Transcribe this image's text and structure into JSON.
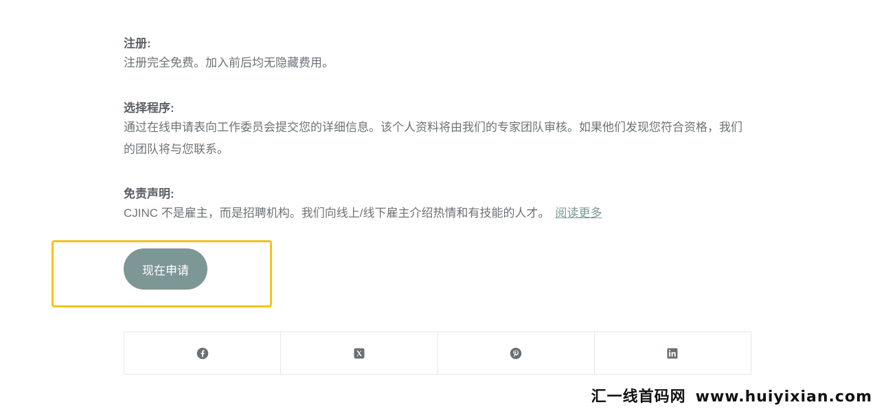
{
  "sections": {
    "registration": {
      "title": "注册:",
      "body": "注册完全免费。加入前后均无隐藏费用。"
    },
    "selection": {
      "title": "选择程序:",
      "body": "通过在线申请表向工作委员会提交您的详细信息。该个人资料将由我们的专家团队审核。如果他们发现您符合资格，我们的团队将与您联系。"
    },
    "disclaimer": {
      "title": "免责声明:",
      "body": "CJINC 不是雇主，而是招聘机构。我们向线上/线下雇主介绍热情和有技能的人才。",
      "read_more": "阅读更多"
    }
  },
  "apply_button": {
    "label": "现在申请",
    "color": "#7d9696"
  },
  "highlight_color": "#f5c11b",
  "share_bar": {
    "items": [
      {
        "icon": "facebook-icon"
      },
      {
        "icon": "x-twitter-icon"
      },
      {
        "icon": "pinterest-icon"
      },
      {
        "icon": "linkedin-icon"
      }
    ]
  },
  "watermark": {
    "brand": "汇一线首码网",
    "site": "www.huiyixian.com"
  }
}
